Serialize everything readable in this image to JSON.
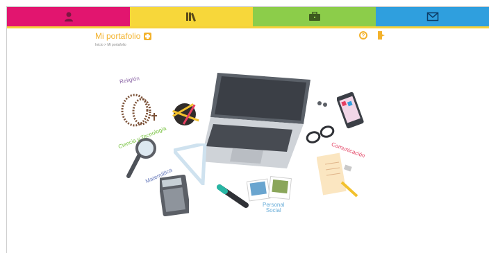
{
  "nav": {
    "tabs": [
      {
        "icon": "user-icon"
      },
      {
        "icon": "books-icon"
      },
      {
        "icon": "briefcase-icon"
      },
      {
        "icon": "envelope-icon"
      }
    ]
  },
  "page": {
    "title": "Mi portafolio",
    "breadcrumb": "Inicio > Mi portafolio"
  },
  "scene": {
    "labels": {
      "religion": "Religión",
      "ciencia": "Ciencia y Tecnología",
      "matematica": "Matemática",
      "comunicacion": "Comunicación",
      "personal_line1": "Personal",
      "personal_line2": "Social"
    }
  },
  "colors": {
    "pink": "#e2156f",
    "yellow": "#f7d73a",
    "green": "#8ccd4a",
    "blue": "#2f9fde",
    "accent": "#f3b22c"
  }
}
